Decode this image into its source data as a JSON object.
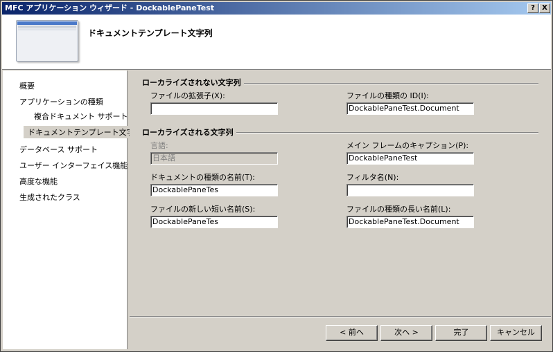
{
  "window": {
    "title": "MFC アプリケーション ウィザード - DockablePaneTest",
    "help_label": "?",
    "close_label": "X"
  },
  "header": {
    "title": "ドキュメントテンプレート文字列"
  },
  "nav": {
    "items": [
      {
        "label": "概要"
      },
      {
        "label": "アプリケーションの種類"
      },
      {
        "label": "複合ドキュメント サポート"
      },
      {
        "label": "ドキュメントテンプレート文字列"
      },
      {
        "label": "データベース サポート"
      },
      {
        "label": "ユーザー インターフェイス機能"
      },
      {
        "label": "高度な機能"
      },
      {
        "label": "生成されたクラス"
      }
    ]
  },
  "groups": {
    "nonlocalized": "ローカライズされない文字列",
    "localized": "ローカライズされる文字列"
  },
  "fields": {
    "extension": {
      "label": "ファイルの拡張子(X):",
      "value": ""
    },
    "filetype_id": {
      "label": "ファイルの種類の ID(I):",
      "value": "DockablePaneTest.Document"
    },
    "language": {
      "label": "言語:",
      "value": "日本語"
    },
    "main_caption": {
      "label": "メイン フレームのキャプション(P):",
      "value": "DockablePaneTest"
    },
    "doc_type_name": {
      "label": "ドキュメントの種類の名前(T):",
      "value": "DockablePaneTes"
    },
    "filter_name": {
      "label": "フィルタ名(N):",
      "value": ""
    },
    "new_short_name": {
      "label": "ファイルの新しい短い名前(S):",
      "value": "DockablePaneTes"
    },
    "filetype_long_name": {
      "label": "ファイルの種類の長い名前(L):",
      "value": "DockablePaneTest.Document"
    }
  },
  "buttons": {
    "back": "< 前へ",
    "next": "次へ >",
    "finish": "完了",
    "cancel": "キャンセル"
  }
}
